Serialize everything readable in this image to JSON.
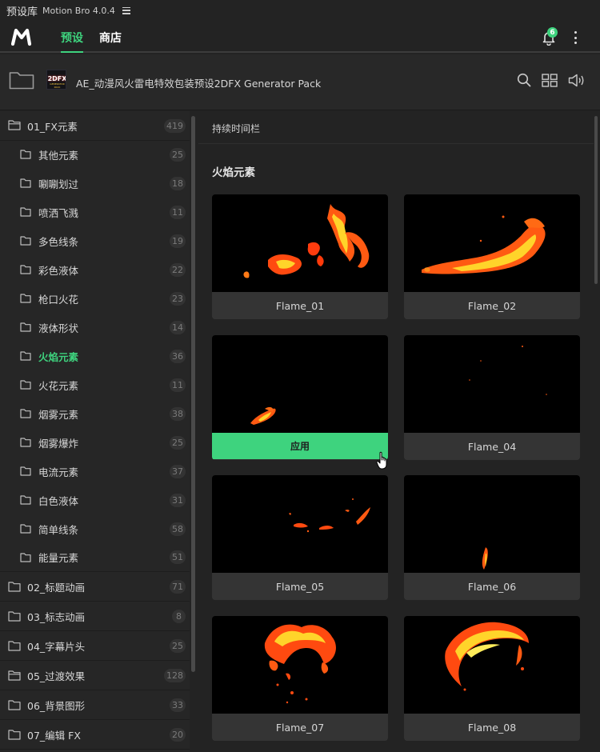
{
  "window": {
    "title": "预设库",
    "subtitle": "Motion Bro 4.0.4"
  },
  "nav": {
    "tabs": [
      {
        "label": "预设",
        "active": true
      },
      {
        "label": "商店",
        "active": false
      }
    ],
    "notification_count": "6"
  },
  "pack": {
    "title": "AE_动漫风火雷电特效包装预设2DFX Generator Pack",
    "thumb_text": "2DFX",
    "thumb_sub": "GENERATOR PACK"
  },
  "sidebar": {
    "categories": [
      {
        "label": "01_FX元素",
        "count": "419",
        "expanded": true
      },
      {
        "label": "02_标题动画",
        "count": "71"
      },
      {
        "label": "03_标志动画",
        "count": "8"
      },
      {
        "label": "04_字幕片头",
        "count": "25"
      },
      {
        "label": "05_过渡效果",
        "count": "128"
      },
      {
        "label": "06_背景图形",
        "count": "33"
      },
      {
        "label": "07_编辑 FX",
        "count": "20"
      }
    ],
    "subitems": [
      {
        "label": "其他元素",
        "count": "25"
      },
      {
        "label": "唰唰划过",
        "count": "18"
      },
      {
        "label": "喷洒飞溅",
        "count": "11"
      },
      {
        "label": "多色线条",
        "count": "19"
      },
      {
        "label": "彩色液体",
        "count": "22"
      },
      {
        "label": "枪口火花",
        "count": "23"
      },
      {
        "label": "液体形状",
        "count": "14"
      },
      {
        "label": "火焰元素",
        "count": "36",
        "active": true
      },
      {
        "label": "火花元素",
        "count": "11"
      },
      {
        "label": "烟雾元素",
        "count": "38"
      },
      {
        "label": "烟雾爆炸",
        "count": "25"
      },
      {
        "label": "电流元素",
        "count": "37"
      },
      {
        "label": "白色液体",
        "count": "31"
      },
      {
        "label": "简单线条",
        "count": "58"
      },
      {
        "label": "能量元素",
        "count": "51"
      }
    ]
  },
  "main": {
    "duration_label": "持续时间栏",
    "section_title": "火焰元素",
    "apply_label": "应用",
    "cards": [
      {
        "name": "Flame_01"
      },
      {
        "name": "Flame_02"
      },
      {
        "name": "Flame_03",
        "hovered": true
      },
      {
        "name": "Flame_04"
      },
      {
        "name": "Flame_05"
      },
      {
        "name": "Flame_06"
      },
      {
        "name": "Flame_07"
      },
      {
        "name": "Flame_08"
      }
    ]
  },
  "colors": {
    "accent": "#3ed37e",
    "background": "#232323",
    "sidebar": "#262626",
    "card": "#2f2f2f"
  },
  "icons": [
    "menu-icon",
    "logo-icon",
    "bell-icon",
    "more-icon",
    "folder-icon",
    "search-icon",
    "grid-icon",
    "speaker-icon",
    "hand-cursor-icon"
  ]
}
